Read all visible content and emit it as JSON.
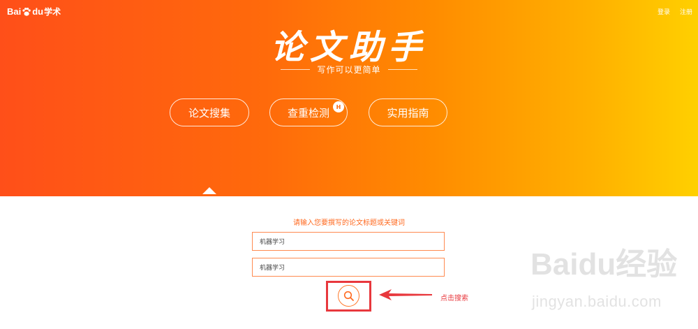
{
  "header": {
    "logo": {
      "left": "Bai",
      "right": "du",
      "suffix": "学术"
    },
    "nav": {
      "login": "登录",
      "register": "注册"
    }
  },
  "hero": {
    "title": "论文助手",
    "subtitle": "写作可以更简单",
    "buttons": [
      {
        "label": "论文搜集"
      },
      {
        "label": "查重检测",
        "badge": "H"
      },
      {
        "label": "实用指南"
      }
    ]
  },
  "form": {
    "prompt": "请输入您要撰写的论文标题或关键词",
    "title_input": {
      "value": "机器学习"
    },
    "keyword_input": {
      "value": "机器学习"
    }
  },
  "annotation": {
    "label": "点击搜索",
    "color": "#e8383d"
  },
  "watermark": {
    "brand": "Baidu经验",
    "url": "jingyan.baidu.com"
  },
  "colors": {
    "gradient_start": "#ff4f19",
    "gradient_end": "#ffd000",
    "accent": "#ff6a20"
  }
}
